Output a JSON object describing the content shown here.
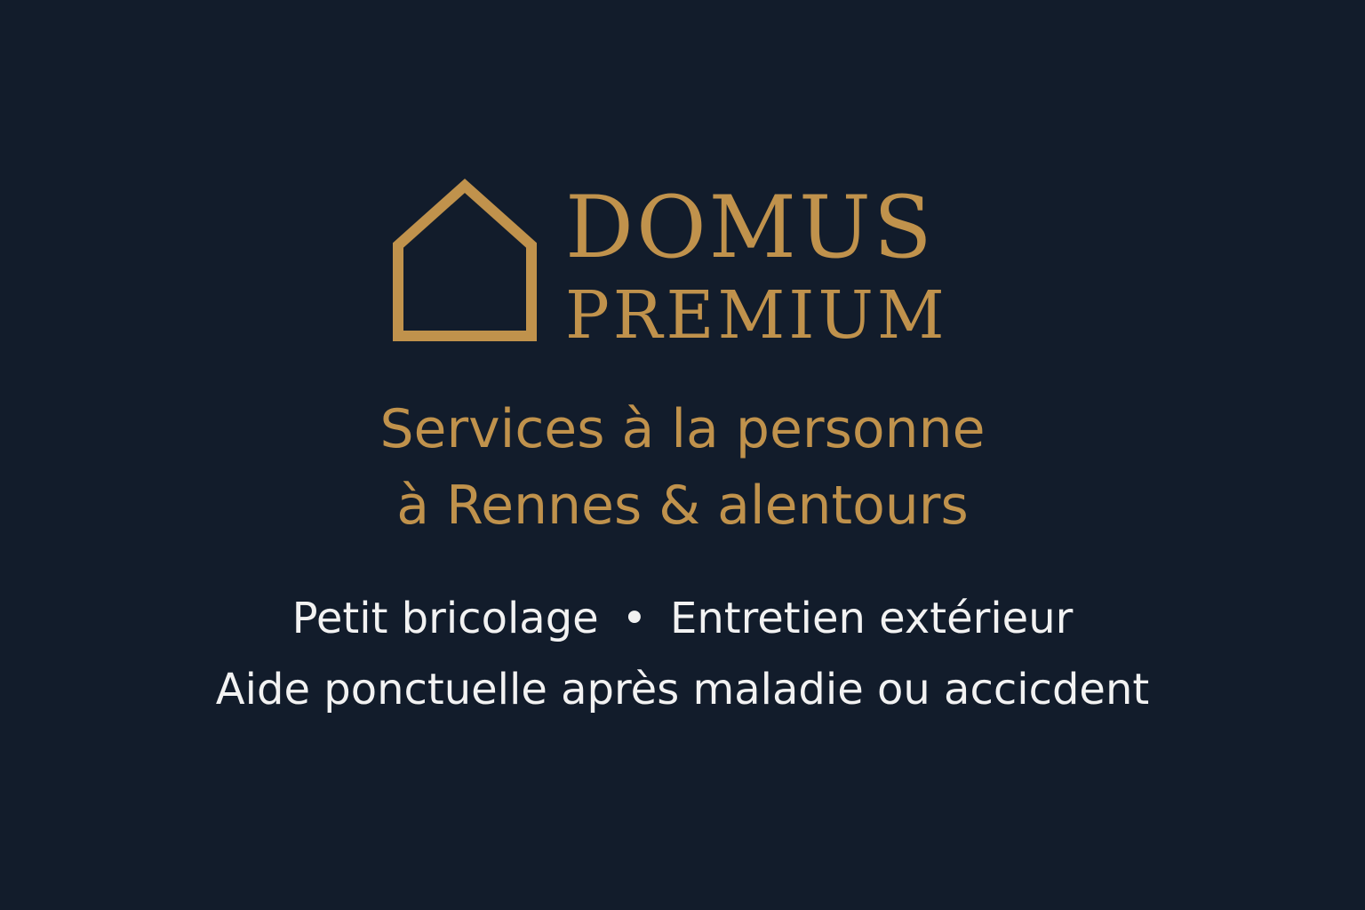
{
  "colors": {
    "background": "#121c2b",
    "gold": "#c0924c",
    "white": "#f2f2f2"
  },
  "logo": {
    "icon": "house-outline-icon",
    "brand_line_1": "DOMUS",
    "brand_line_2": "PREMIUM"
  },
  "tagline": {
    "line_1": "Services à la personne",
    "line_2": "à Rennes & alentours"
  },
  "services": {
    "item_1": "Petit bricolage",
    "separator": "•",
    "item_2": "Entretien extérieur",
    "item_3": "Aide ponctuelle après maladie ou accicdent"
  }
}
